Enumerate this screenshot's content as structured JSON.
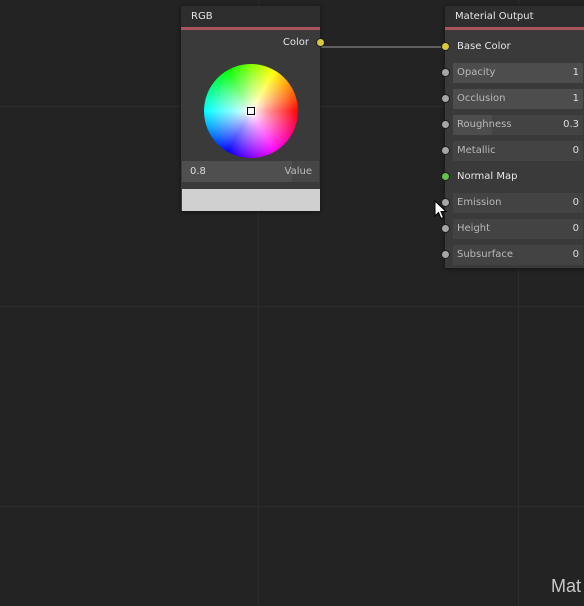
{
  "rgb_node": {
    "title": "RGB",
    "output_label": "Color",
    "slider_value": "0.8",
    "slider_fraction": 0.8,
    "slider_label": "Value",
    "preview_color": "#d0d0d0",
    "accent_color": "#a9545c"
  },
  "material_node": {
    "title": "Material Output",
    "inputs": [
      {
        "label": "Base Color",
        "socket": "yellow",
        "kind": "plain"
      },
      {
        "label": "Opacity",
        "value": "1",
        "fraction": 1.0,
        "socket": "gray",
        "kind": "field"
      },
      {
        "label": "Occlusion",
        "value": "1",
        "fraction": 1.0,
        "socket": "gray",
        "kind": "field"
      },
      {
        "label": "Roughness",
        "value": "0.3",
        "fraction": 0.3,
        "socket": "gray",
        "kind": "field"
      },
      {
        "label": "Metallic",
        "value": "0",
        "fraction": 0.0,
        "socket": "gray",
        "kind": "field"
      },
      {
        "label": "Normal Map",
        "socket": "green",
        "kind": "plain"
      },
      {
        "label": "Emission",
        "value": "0",
        "fraction": 0.0,
        "socket": "gray",
        "kind": "field"
      },
      {
        "label": "Height",
        "value": "0",
        "fraction": 0.0,
        "socket": "gray",
        "kind": "field"
      },
      {
        "label": "Subsurface",
        "value": "0",
        "fraction": 0.0,
        "socket": "gray",
        "kind": "field"
      }
    ]
  },
  "corner_label": "Mat",
  "colors": {
    "background": "#232323",
    "node_body": "#3a3a3a",
    "socket_yellow": "#d8c83a",
    "socket_green": "#62c24c",
    "socket_gray": "#a6a6a6",
    "wire": "#9a9a9a"
  }
}
